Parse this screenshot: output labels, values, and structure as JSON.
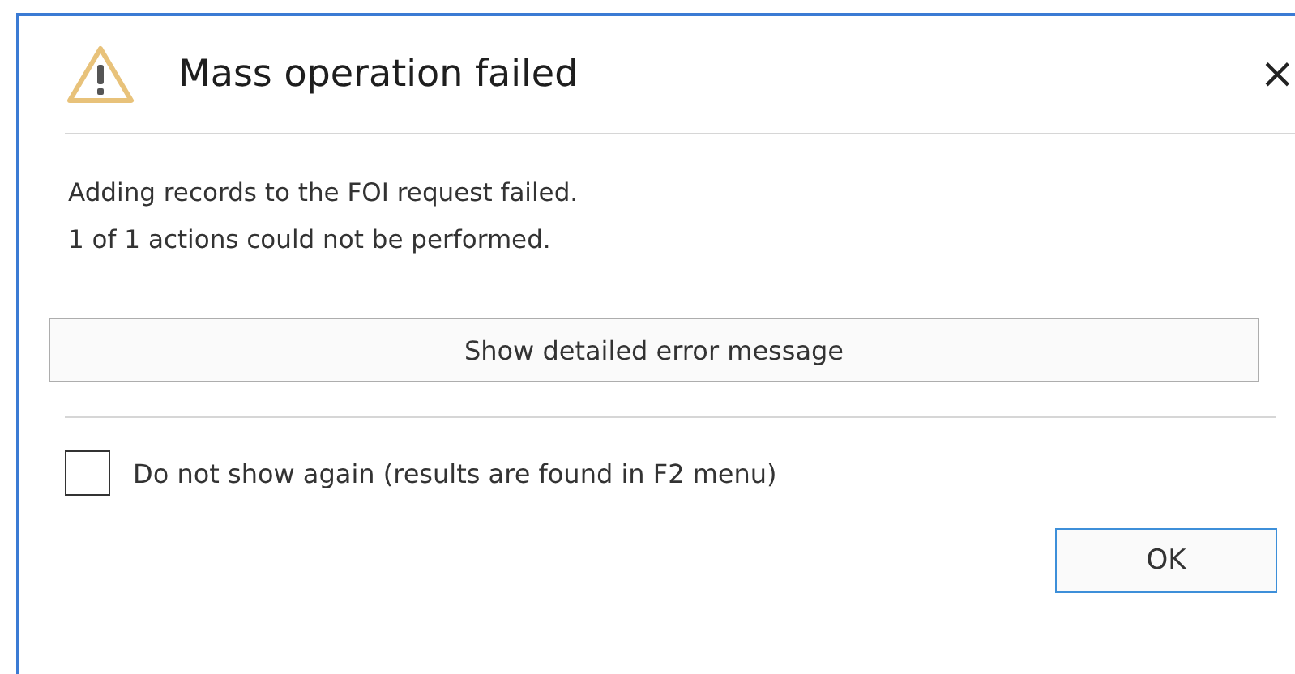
{
  "dialog": {
    "title": "Mass operation failed",
    "close": "×",
    "message": [
      "Adding records to the FOI request failed.",
      "1 of 1 actions could not be performed."
    ],
    "details_button": "Show detailed error message",
    "checkbox": {
      "label": "Do not show again (results are found in F2 menu)",
      "checked": false
    },
    "ok_button": "OK"
  }
}
